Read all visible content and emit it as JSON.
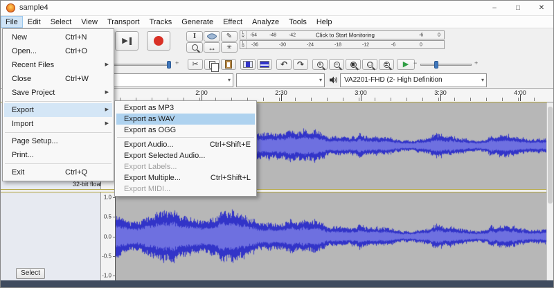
{
  "window": {
    "title": "sample4"
  },
  "window_controls": {
    "minimize": "–",
    "maximize": "□",
    "close": "✕"
  },
  "menubar": [
    "File",
    "Edit",
    "Select",
    "View",
    "Transport",
    "Tracks",
    "Generate",
    "Effect",
    "Analyze",
    "Tools",
    "Help"
  ],
  "active_menu": "File",
  "file_menu": [
    {
      "label": "New",
      "shortcut": "Ctrl+N"
    },
    {
      "label": "Open...",
      "shortcut": "Ctrl+O"
    },
    {
      "label": "Recent Files",
      "submenu": true
    },
    {
      "label": "Close",
      "shortcut": "Ctrl+W"
    },
    {
      "label": "Save Project",
      "submenu": true
    },
    {
      "sep": true
    },
    {
      "label": "Export",
      "submenu": true,
      "state": "open"
    },
    {
      "label": "Import",
      "submenu": true
    },
    {
      "sep": true
    },
    {
      "label": "Page Setup..."
    },
    {
      "label": "Print..."
    },
    {
      "sep": true
    },
    {
      "label": "Exit",
      "shortcut": "Ctrl+Q"
    }
  ],
  "export_submenu": [
    {
      "label": "Export as MP3"
    },
    {
      "label": "Export as WAV",
      "state": "highlighted"
    },
    {
      "label": "Export as OGG"
    },
    {
      "sep": true
    },
    {
      "label": "Export Audio...",
      "shortcut": "Ctrl+Shift+E"
    },
    {
      "label": "Export Selected Audio..."
    },
    {
      "label": "Export Labels...",
      "disabled": true
    },
    {
      "label": "Export Multiple...",
      "shortcut": "Ctrl+Shift+L"
    },
    {
      "label": "Export MIDI...",
      "disabled": true
    }
  ],
  "meters": {
    "record": {
      "channels": [
        "L",
        "R"
      ],
      "scale_left": [
        "-54",
        "-48",
        "-42"
      ],
      "message": "Click to Start Monitoring",
      "scale_right": [
        "-6",
        "0"
      ]
    },
    "playback": {
      "channels": [
        "L",
        "R"
      ],
      "scale": [
        "-36",
        "-30",
        "-24",
        "-18",
        "-12",
        "-6",
        "0"
      ]
    }
  },
  "mixer": {
    "minus": "−",
    "plus": "+"
  },
  "zoom_buttons": [
    {
      "name": "zoom-in",
      "glyph": "+"
    },
    {
      "name": "zoom-out",
      "glyph": "−"
    },
    {
      "name": "zoom-to-selection",
      "glyph": "▣"
    },
    {
      "name": "zoom-to-fit",
      "glyph": "□"
    },
    {
      "name": "zoom-toggle",
      "glyph": "±"
    }
  ],
  "device_toolbar": {
    "playback_device": "VA2201-FHD (2- High Definition"
  },
  "timeline": {
    "labels": [
      "2:00",
      "2:30",
      "3:00",
      "3:30",
      "4:00"
    ]
  },
  "tracks": {
    "info_format": "32-bit float",
    "select_button": "Select",
    "vertical_scale": [
      "1.0",
      "0.5",
      "0.0",
      "-0.5",
      "-1.0"
    ]
  },
  "icons": {
    "play": "▶",
    "stop": "■",
    "skip_back": "◀",
    "selection": "I",
    "draw": "✎",
    "time_shift": "↔",
    "multi": "✳",
    "cut": "✂",
    "undo": "↶",
    "redo": "↷",
    "combo_arrow": "▾",
    "submenu_arrow": "▶",
    "speed_play": "▶"
  },
  "colors": {
    "waveform": "#3234c8",
    "waveform_rms": "#6e70e0",
    "track_bg": "#b7b7b7",
    "record_red": "#d93025",
    "play_green": "#2f9e44",
    "selection_blue": "#aed2ef",
    "statusbar": "#3f4b5e"
  }
}
